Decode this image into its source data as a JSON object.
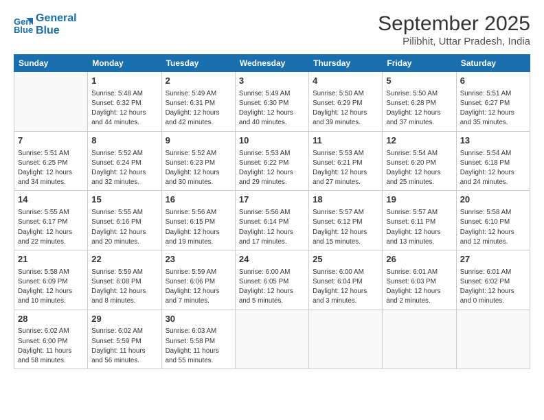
{
  "header": {
    "logo_line1": "General",
    "logo_line2": "Blue",
    "month": "September 2025",
    "location": "Pilibhit, Uttar Pradesh, India"
  },
  "weekdays": [
    "Sunday",
    "Monday",
    "Tuesday",
    "Wednesday",
    "Thursday",
    "Friday",
    "Saturday"
  ],
  "weeks": [
    [
      {
        "day": "",
        "info": ""
      },
      {
        "day": "1",
        "info": "Sunrise: 5:48 AM\nSunset: 6:32 PM\nDaylight: 12 hours\nand 44 minutes."
      },
      {
        "day": "2",
        "info": "Sunrise: 5:49 AM\nSunset: 6:31 PM\nDaylight: 12 hours\nand 42 minutes."
      },
      {
        "day": "3",
        "info": "Sunrise: 5:49 AM\nSunset: 6:30 PM\nDaylight: 12 hours\nand 40 minutes."
      },
      {
        "day": "4",
        "info": "Sunrise: 5:50 AM\nSunset: 6:29 PM\nDaylight: 12 hours\nand 39 minutes."
      },
      {
        "day": "5",
        "info": "Sunrise: 5:50 AM\nSunset: 6:28 PM\nDaylight: 12 hours\nand 37 minutes."
      },
      {
        "day": "6",
        "info": "Sunrise: 5:51 AM\nSunset: 6:27 PM\nDaylight: 12 hours\nand 35 minutes."
      }
    ],
    [
      {
        "day": "7",
        "info": "Sunrise: 5:51 AM\nSunset: 6:25 PM\nDaylight: 12 hours\nand 34 minutes."
      },
      {
        "day": "8",
        "info": "Sunrise: 5:52 AM\nSunset: 6:24 PM\nDaylight: 12 hours\nand 32 minutes."
      },
      {
        "day": "9",
        "info": "Sunrise: 5:52 AM\nSunset: 6:23 PM\nDaylight: 12 hours\nand 30 minutes."
      },
      {
        "day": "10",
        "info": "Sunrise: 5:53 AM\nSunset: 6:22 PM\nDaylight: 12 hours\nand 29 minutes."
      },
      {
        "day": "11",
        "info": "Sunrise: 5:53 AM\nSunset: 6:21 PM\nDaylight: 12 hours\nand 27 minutes."
      },
      {
        "day": "12",
        "info": "Sunrise: 5:54 AM\nSunset: 6:20 PM\nDaylight: 12 hours\nand 25 minutes."
      },
      {
        "day": "13",
        "info": "Sunrise: 5:54 AM\nSunset: 6:18 PM\nDaylight: 12 hours\nand 24 minutes."
      }
    ],
    [
      {
        "day": "14",
        "info": "Sunrise: 5:55 AM\nSunset: 6:17 PM\nDaylight: 12 hours\nand 22 minutes."
      },
      {
        "day": "15",
        "info": "Sunrise: 5:55 AM\nSunset: 6:16 PM\nDaylight: 12 hours\nand 20 minutes."
      },
      {
        "day": "16",
        "info": "Sunrise: 5:56 AM\nSunset: 6:15 PM\nDaylight: 12 hours\nand 19 minutes."
      },
      {
        "day": "17",
        "info": "Sunrise: 5:56 AM\nSunset: 6:14 PM\nDaylight: 12 hours\nand 17 minutes."
      },
      {
        "day": "18",
        "info": "Sunrise: 5:57 AM\nSunset: 6:12 PM\nDaylight: 12 hours\nand 15 minutes."
      },
      {
        "day": "19",
        "info": "Sunrise: 5:57 AM\nSunset: 6:11 PM\nDaylight: 12 hours\nand 13 minutes."
      },
      {
        "day": "20",
        "info": "Sunrise: 5:58 AM\nSunset: 6:10 PM\nDaylight: 12 hours\nand 12 minutes."
      }
    ],
    [
      {
        "day": "21",
        "info": "Sunrise: 5:58 AM\nSunset: 6:09 PM\nDaylight: 12 hours\nand 10 minutes."
      },
      {
        "day": "22",
        "info": "Sunrise: 5:59 AM\nSunset: 6:08 PM\nDaylight: 12 hours\nand 8 minutes."
      },
      {
        "day": "23",
        "info": "Sunrise: 5:59 AM\nSunset: 6:06 PM\nDaylight: 12 hours\nand 7 minutes."
      },
      {
        "day": "24",
        "info": "Sunrise: 6:00 AM\nSunset: 6:05 PM\nDaylight: 12 hours\nand 5 minutes."
      },
      {
        "day": "25",
        "info": "Sunrise: 6:00 AM\nSunset: 6:04 PM\nDaylight: 12 hours\nand 3 minutes."
      },
      {
        "day": "26",
        "info": "Sunrise: 6:01 AM\nSunset: 6:03 PM\nDaylight: 12 hours\nand 2 minutes."
      },
      {
        "day": "27",
        "info": "Sunrise: 6:01 AM\nSunset: 6:02 PM\nDaylight: 12 hours\nand 0 minutes."
      }
    ],
    [
      {
        "day": "28",
        "info": "Sunrise: 6:02 AM\nSunset: 6:00 PM\nDaylight: 11 hours\nand 58 minutes."
      },
      {
        "day": "29",
        "info": "Sunrise: 6:02 AM\nSunset: 5:59 PM\nDaylight: 11 hours\nand 56 minutes."
      },
      {
        "day": "30",
        "info": "Sunrise: 6:03 AM\nSunset: 5:58 PM\nDaylight: 11 hours\nand 55 minutes."
      },
      {
        "day": "",
        "info": ""
      },
      {
        "day": "",
        "info": ""
      },
      {
        "day": "",
        "info": ""
      },
      {
        "day": "",
        "info": ""
      }
    ]
  ]
}
